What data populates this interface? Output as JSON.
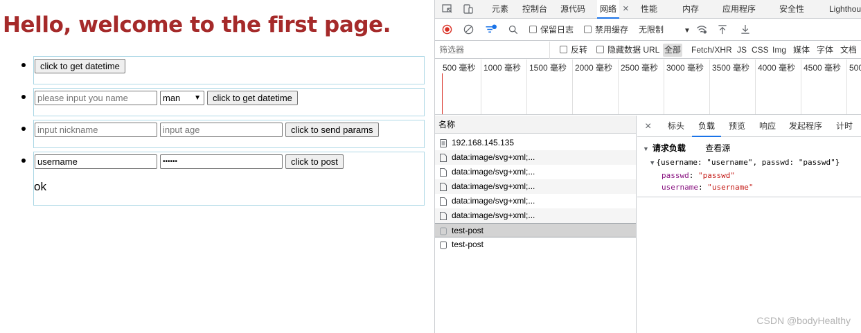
{
  "page": {
    "heading": "Hello, welcome to the first page.",
    "section1": {
      "button": "click to get datetime"
    },
    "section2": {
      "name_placeholder": "please input you name",
      "gender_value": "man",
      "button": "click to get datetime"
    },
    "section3": {
      "nickname_placeholder": "input nickname",
      "age_placeholder": "input age",
      "button": "click to send params"
    },
    "section4": {
      "username_value": "username",
      "password_value": "••••••",
      "button": "click to post",
      "result": "ok"
    }
  },
  "devtools": {
    "tabs": [
      "元素",
      "控制台",
      "源代码",
      "网络",
      "性能",
      "内存",
      "应用程序",
      "安全性",
      "Lighthou"
    ],
    "toolbar": {
      "preserve_log": "保留日志",
      "disable_cache": "禁用缓存",
      "throttle": "无限制"
    },
    "filter": {
      "placeholder": "筛选器",
      "invert": "反转",
      "hide_data_url": "隐藏数据 URL",
      "types": [
        "全部",
        "Fetch/XHR",
        "JS",
        "CSS",
        "Img",
        "媒体",
        "字体",
        "文档"
      ]
    },
    "timeline_ticks": [
      "500 毫秒",
      "1000 毫秒",
      "1500 毫秒",
      "2000 毫秒",
      "2500 毫秒",
      "3000 毫秒",
      "3500 毫秒",
      "4000 毫秒",
      "4500 毫秒",
      "500"
    ],
    "requests": {
      "header": "名称",
      "items": [
        "192.168.145.135",
        "data:image/svg+xml;...",
        "data:image/svg+xml;...",
        "data:image/svg+xml;...",
        "data:image/svg+xml;...",
        "data:image/svg+xml;...",
        "test-post",
        "test-post"
      ]
    },
    "detail_tabs": [
      "标头",
      "负载",
      "预览",
      "响应",
      "发起程序",
      "计时"
    ],
    "payload": {
      "section_title": "请求负载",
      "view_source": "查看源",
      "summary": "{username: \"username\", passwd: \"passwd\"}",
      "fields": [
        {
          "key": "passwd",
          "value": "\"passwd\""
        },
        {
          "key": "username",
          "value": "\"username\""
        }
      ]
    }
  },
  "watermark": "CSDN @bodyHealthy",
  "colors": {
    "heading": "#a52a2a",
    "box_border": "#add8e6",
    "accent": "#1a73e8"
  }
}
